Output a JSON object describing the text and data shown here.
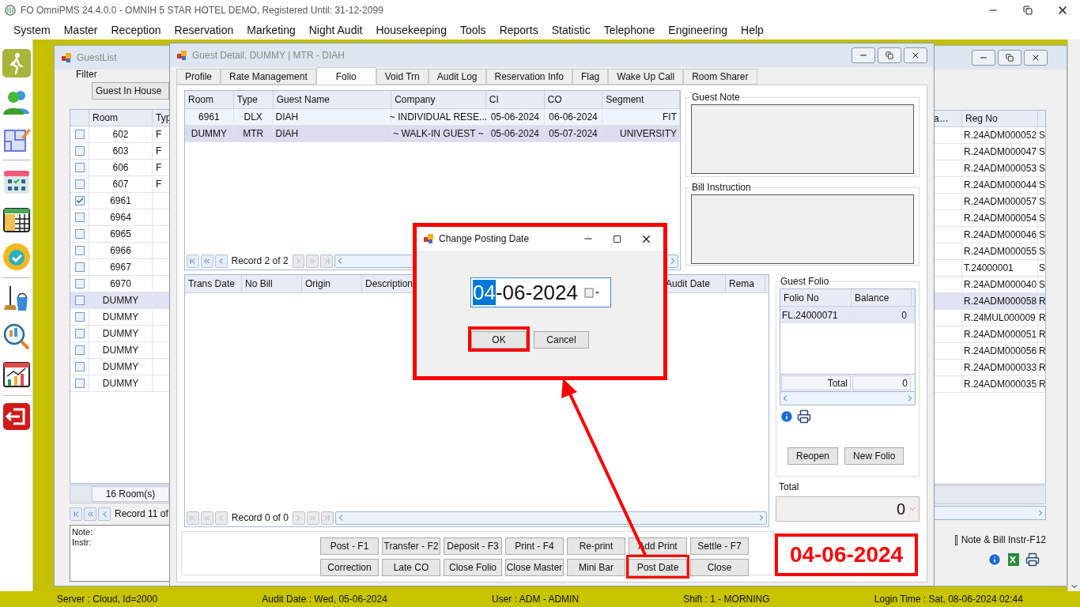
{
  "app": {
    "title": "FO OmniPMS 24.4.0.0 - OMNIH 5 STAR HOTEL DEMO, Registered Until: 31-12-2099"
  },
  "menu": [
    "System",
    "Master",
    "Reception",
    "Reservation",
    "Marketing",
    "Night Audit",
    "Housekeeping",
    "Tools",
    "Reports",
    "Statistic",
    "Telephone",
    "Engineering",
    "Help"
  ],
  "guest_list": {
    "title": "GuestList",
    "filter_label": "Filter",
    "filter_value": "Guest In House",
    "columns_left": [
      "Room",
      "Typ"
    ],
    "columns_right": [
      "a…",
      "Reg No"
    ],
    "rows": [
      {
        "room": "602",
        "type": "F",
        "reg_no": "R.24ADM000052",
        "column_r": "S",
        "checked": false,
        "selected": false
      },
      {
        "room": "603",
        "type": "F",
        "reg_no": "R.24ADM000047",
        "column_r": "S",
        "checked": false,
        "selected": false
      },
      {
        "room": "606",
        "type": "F",
        "reg_no": "R.24ADM000053",
        "column_r": "S",
        "checked": false,
        "selected": false
      },
      {
        "room": "607",
        "type": "F",
        "reg_no": "R.24ADM000044",
        "column_r": "S",
        "checked": false,
        "selected": false
      },
      {
        "room": "6961",
        "reg_no": "R.24ADM000057",
        "column_r": "S",
        "checked": true,
        "selected": false
      },
      {
        "room": "6964",
        "reg_no": "R.24ADM000054",
        "column_r": "S",
        "checked": false,
        "selected": false
      },
      {
        "room": "6965",
        "reg_no": "R.24ADM000046",
        "column_r": "S",
        "checked": false,
        "selected": false
      },
      {
        "room": "6966",
        "reg_no": "R.24ADM000055",
        "column_r": "S",
        "checked": false,
        "selected": false
      },
      {
        "room": "6967",
        "reg_no": "T.24000001",
        "column_r": "S",
        "checked": false,
        "selected": false
      },
      {
        "room": "6970",
        "reg_no": "R.24ADM000040",
        "column_r": "S",
        "checked": false,
        "selected": false
      },
      {
        "room": "DUMMY",
        "reg_no": "R.24ADM000058",
        "column_r": "R",
        "checked": false,
        "selected": true
      },
      {
        "room": "DUMMY",
        "reg_no": "R.24MUL000009",
        "column_r": "R",
        "checked": false,
        "selected": false
      },
      {
        "room": "DUMMY",
        "reg_no": "R.24ADM000051",
        "column_r": "R",
        "checked": false,
        "selected": false
      },
      {
        "room": "DUMMY",
        "reg_no": "R.24ADM000056",
        "column_r": "R",
        "checked": false,
        "selected": false
      },
      {
        "room": "DUMMY",
        "reg_no": "R.24ADM000033",
        "column_r": "R",
        "checked": false,
        "selected": false
      },
      {
        "room": "DUMMY",
        "reg_no": "R.24ADM000035",
        "column_r": "R",
        "checked": false,
        "selected": false
      }
    ],
    "room_count": "16 Room(s)",
    "record": "Record 11 of",
    "note_label": "Note:",
    "instr_label": "Instr:",
    "note_checkbox": {
      "label": "Note & Bill Instr-F12",
      "checked": false
    }
  },
  "guest_detail": {
    "title": "Guest Detail. DUMMY | MTR - DIAH",
    "tabs": [
      {
        "label": "Profile",
        "selected": false
      },
      {
        "label": "Rate Management",
        "selected": false
      },
      {
        "label": "Folio",
        "selected": true
      },
      {
        "label": "Void Trn",
        "selected": false
      },
      {
        "label": "Audit Log",
        "selected": false
      },
      {
        "label": "Reservation Info",
        "selected": false
      },
      {
        "label": "Flag",
        "selected": false
      },
      {
        "label": "Wake Up Call",
        "selected": false
      },
      {
        "label": "Room Sharer",
        "selected": false
      }
    ],
    "stays": {
      "columns": [
        "Room",
        "Type",
        "Guest Name",
        "Company",
        "CI",
        "CO",
        "Segment"
      ],
      "rows": [
        {
          "cells": [
            "6961",
            "DLX",
            "DIAH",
            "~ INDIVIDUAL RESE...",
            "05-06-2024",
            "06-06-2024",
            "FIT"
          ],
          "selected": false
        },
        {
          "cells": [
            "DUMMY",
            "MTR",
            "DIAH",
            "~ WALK-IN GUEST ~",
            "05-06-2024",
            "05-07-2024",
            "UNIVERSITY"
          ],
          "selected": true
        }
      ],
      "record": "Record 2 of 2"
    },
    "transactions": {
      "columns": [
        "Trans Date",
        "No Bill",
        "Origin",
        "Description",
        "Audit Date",
        "Rema"
      ],
      "record": "Record 0 of 0"
    },
    "guest_note": {
      "label": "Guest Note"
    },
    "bill_instruction": {
      "label": "Bill Instruction"
    },
    "guest_folio": {
      "label": "Guest Folio",
      "columns": [
        "Folio No",
        "Balance"
      ],
      "rows": [
        {
          "folio_no": "FL.24000071",
          "balance": "0",
          "selected": true
        }
      ],
      "total_label": "Total",
      "total": "0",
      "buttons": [
        "Reopen",
        "New Folio"
      ]
    },
    "total": {
      "label": "Total",
      "value": "0"
    },
    "buttons": [
      {
        "label": "Post - F1",
        "highlighted": false
      },
      {
        "label": "Transfer - F2",
        "highlighted": false
      },
      {
        "label": "Deposit - F3",
        "highlighted": false
      },
      {
        "label": "Print - F4",
        "highlighted": false
      },
      {
        "label": "Re-print",
        "highlighted": false
      },
      {
        "label": "Add Print",
        "highlighted": false
      },
      {
        "label": "Settle - F7",
        "highlighted": false
      },
      {
        "label": "Correction",
        "highlighted": false
      },
      {
        "label": "Late CO",
        "highlighted": false
      },
      {
        "label": "Close Folio",
        "highlighted": false
      },
      {
        "label": "Close Master",
        "highlighted": false
      },
      {
        "label": "Mini Bar",
        "highlighted": false
      },
      {
        "label": "Post Date",
        "highlighted": true
      },
      {
        "label": "Close",
        "highlighted": false
      }
    ]
  },
  "dialog": {
    "title": "Change Posting Date",
    "date_selected": "04",
    "date_rest": "-06-2024",
    "buttons": [
      {
        "label": "OK",
        "highlighted": true
      },
      {
        "label": "Cancel",
        "highlighted": false
      }
    ]
  },
  "callout": {
    "text": "04-06-2024"
  },
  "status_bar": [
    "Server : Cloud, Id=2000",
    "Audit Date : Wed, 05-06-2024",
    "User : ADM - ADMIN",
    "Shift : 1 - MORNING",
    "Login Time : Sat, 08-06-2024 02:44"
  ]
}
